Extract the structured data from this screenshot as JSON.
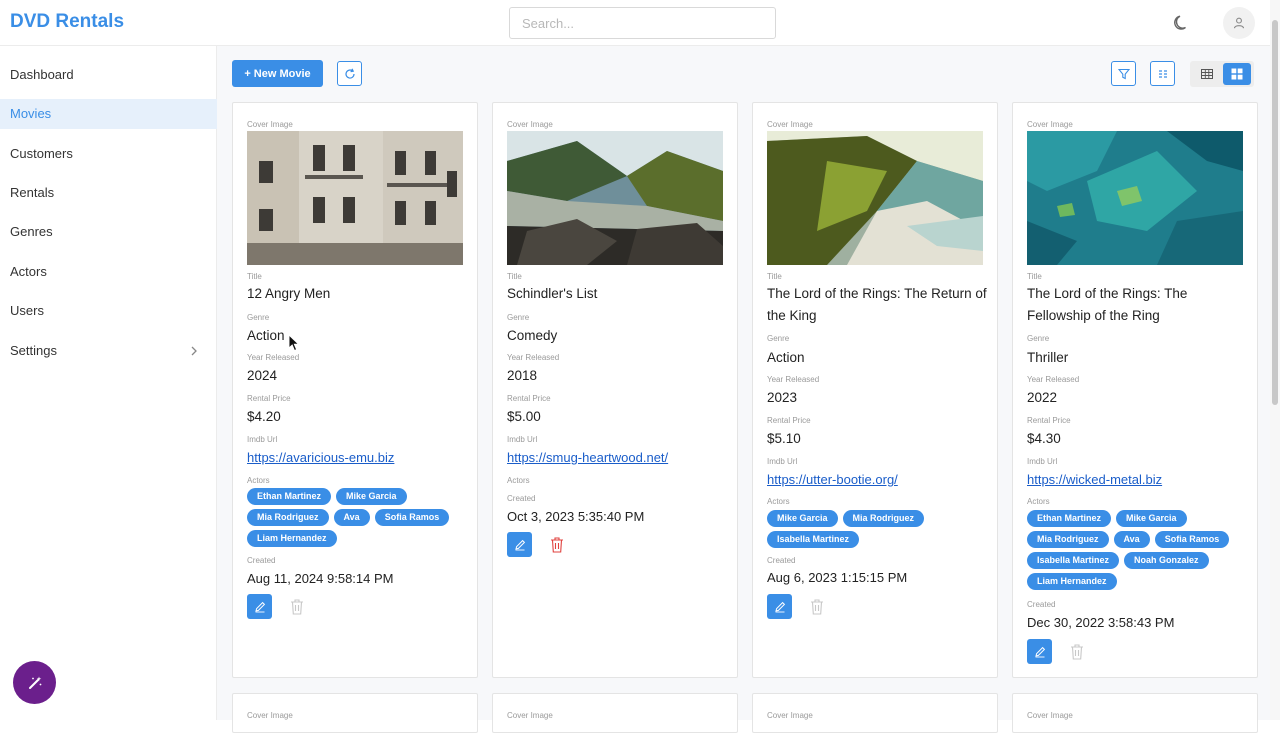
{
  "app": {
    "title": "DVD Rentals"
  },
  "search": {
    "placeholder": "Search..."
  },
  "icons": {
    "theme": "moon-icon",
    "user": "user-icon",
    "magic": "magic-wand-icon"
  },
  "colors": {
    "accent": "#3a8ee6",
    "active_bg": "#e6f0fb",
    "danger": "#e0413e",
    "fab": "#6b1f8c"
  },
  "sidebar": {
    "items": [
      {
        "label": "Dashboard"
      },
      {
        "label": "Movies",
        "active": true
      },
      {
        "label": "Customers"
      },
      {
        "label": "Rentals"
      },
      {
        "label": "Genres"
      },
      {
        "label": "Actors"
      },
      {
        "label": "Users"
      },
      {
        "label": "Settings",
        "has_children": true
      }
    ]
  },
  "toolbar": {
    "new_label": "+ New Movie",
    "view_mode": "grid"
  },
  "labels": {
    "cover": "Cover Image",
    "title": "Title",
    "genre": "Genre",
    "year": "Year Released",
    "price": "Rental Price",
    "imdb": "Imdb Url",
    "actors": "Actors",
    "created": "Created"
  },
  "movies": [
    {
      "title": "12 Angry Men",
      "genre": "Action",
      "year": "2024",
      "price": "$4.20",
      "imdb": "https://avaricious-emu.biz",
      "actors": [
        "Ethan Martinez",
        "Mike Garcia",
        "Mia Rodriguez",
        "Ava",
        "Sofia Ramos",
        "Liam Hernandez"
      ],
      "created": "Aug 11, 2024 9:58:14 PM",
      "delete_enabled": false
    },
    {
      "title": "Schindler's List",
      "genre": "Comedy",
      "year": "2018",
      "price": "$5.00",
      "imdb": "https://smug-heartwood.net/",
      "actors": [],
      "created": "Oct 3, 2023 5:35:40 PM",
      "delete_enabled": true
    },
    {
      "title": "The Lord of the Rings: The Return of the King",
      "genre": "Action",
      "year": "2023",
      "price": "$5.10",
      "imdb": "https://utter-bootie.org/",
      "actors": [
        "Mike Garcia",
        "Mia Rodriguez",
        "Isabella Martinez"
      ],
      "created": "Aug 6, 2023 1:15:15 PM",
      "delete_enabled": false
    },
    {
      "title": "The Lord of the Rings: The Fellowship of the Ring",
      "genre": "Thriller",
      "year": "2022",
      "price": "$4.30",
      "imdb": "https://wicked-metal.biz",
      "actors": [
        "Ethan Martinez",
        "Mike Garcia",
        "Mia Rodriguez",
        "Ava",
        "Sofia Ramos",
        "Isabella Martinez",
        "Noah Gonzalez",
        "Liam Hernandez"
      ],
      "created": "Dec 30, 2022 3:58:43 PM",
      "delete_enabled": false
    }
  ]
}
